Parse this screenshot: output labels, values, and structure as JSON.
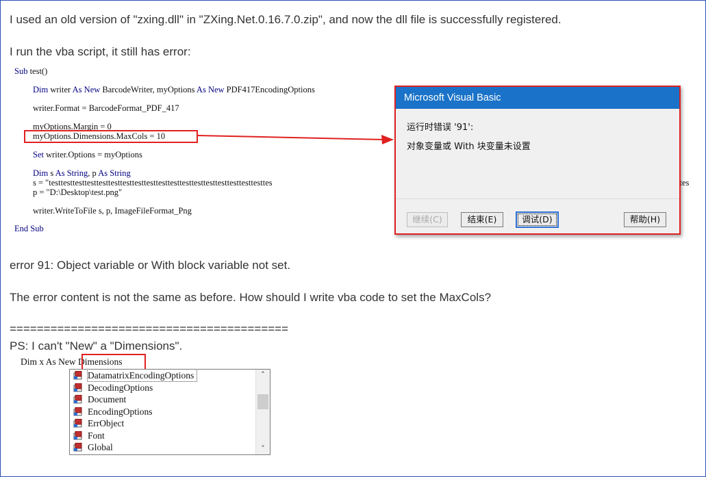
{
  "post": {
    "line1": "I used an old version of \"zxing.dll\" in \"ZXing.Net.0.16.7.0.zip\", and now the dll file is successfully registered.",
    "line2": "I run the vba script, it still has error:",
    "error_line": "error 91: Object variable or With block variable not set.",
    "question": "The error content is not the same as before. How should I write vba code to set the MaxCols?",
    "separator": "=========================================",
    "ps": "PS: I can't \"New\" a \"Dimensions\"."
  },
  "code": {
    "l1_kw": "Sub",
    "l1_rest": " test()",
    "l2_kw1": "Dim",
    "l2_a": " writer ",
    "l2_kw2": "As New",
    "l2_b": " BarcodeWriter, myOptions ",
    "l2_kw3": "As New",
    "l2_c": " PDF417EncodingOptions",
    "l3": "writer.Format = BarcodeFormat_PDF_417",
    "l4": "myOptions.Margin = 0",
    "l5": "myOptions.Dimensions.MaxCols = 10",
    "l6_kw": "Set",
    "l6_rest": " writer.Options = myOptions",
    "l7_kw1": "Dim",
    "l7_a": " s ",
    "l7_kw2": "As String",
    "l7_b": ", p ",
    "l7_kw3": "As String",
    "l8": "s = \"testtesttesttesttesttesttesttesttesttesttesttesttesttesttesttesttesttesttes",
    "l8_tail": "ttes",
    "l9": "p = \"D:\\Desktop\\test.png\"",
    "l10": "writer.WriteToFile s, p, ImageFileFormat_Png",
    "l11_kw": "End Sub"
  },
  "dialog": {
    "title": "Microsoft Visual Basic",
    "msg1": "运行时错误 '91':",
    "msg2": "对象变量或 With 块变量未设置",
    "btn_continue": "继续(C)",
    "btn_end": "结束(E)",
    "btn_debug": "调试(D)",
    "btn_help": "帮助(H)"
  },
  "ps_code": {
    "prefix": "Dim x As New ",
    "typed": "Dimensions"
  },
  "autocomplete": {
    "items": [
      "DatamatrixEncodingOptions",
      "DecodingOptions",
      "Document",
      "EncodingOptions",
      "ErrObject",
      "Font",
      "Global"
    ]
  },
  "colors": {
    "border": "#2d4fb7",
    "highlight": "#e02020",
    "dialog_title": "#1a73c8",
    "keyword": "#00007f"
  }
}
